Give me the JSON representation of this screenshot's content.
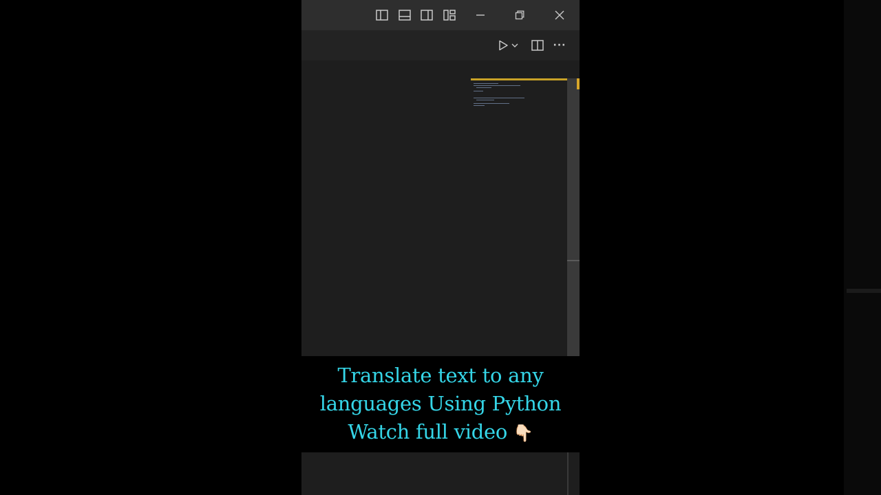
{
  "titlebar": {
    "icons": [
      "toggle-primary-sidebar-icon",
      "toggle-panel-icon",
      "toggle-secondary-sidebar-icon",
      "customize-layout-icon",
      "minimize-icon",
      "restore-icon",
      "close-icon"
    ]
  },
  "toolbar": {
    "icons": [
      "run-icon",
      "chevron-down-icon",
      "split-editor-icon",
      "more-actions-icon"
    ],
    "more_glyph": "···"
  },
  "caption": {
    "line1": "Translate text to any",
    "line2": "languages Using Python",
    "line3": "Watch full video",
    "emoji": "👇🏻"
  },
  "colors": {
    "caption_text": "#35d6e8",
    "accent_yellow": "#d7a62a",
    "titlebar_bg": "#2e2e2e",
    "editor_bg": "#1e1e1e"
  }
}
